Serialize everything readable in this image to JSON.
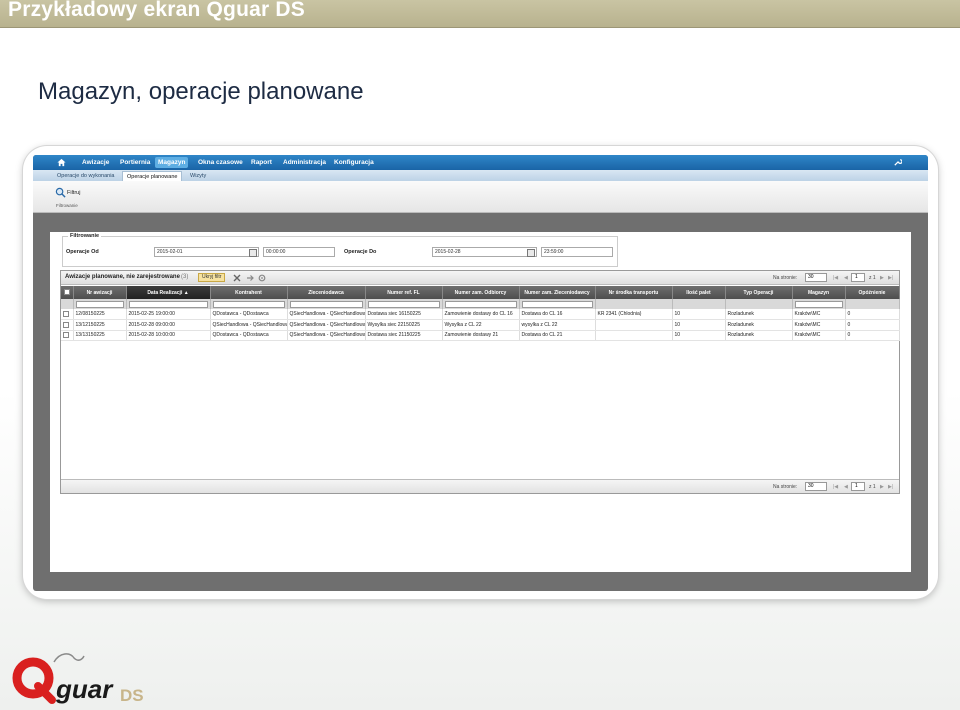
{
  "slide": {
    "header": "Przykładowy ekran Qguar DS",
    "title": "Magazyn, operacje planowane"
  },
  "app": {
    "nav": [
      "Awizacje",
      "Portiernia",
      "Magazyn",
      "Okna czasowe",
      "Raport",
      "Administracja",
      "Konfiguracja"
    ],
    "nav_active": "Magazyn",
    "subnav": [
      "Operacje do wykonania",
      "Operacje planowane",
      "Wizyty"
    ],
    "subnav_active": "Operacje planowane",
    "toolbar": {
      "filter_label": "Filtruj",
      "group_label": "Filtrowanie"
    },
    "filter": {
      "legend": "Filtrowanie",
      "from_label": "Operacje Od",
      "from_date": "2015-02-01",
      "from_time": "00:00:00",
      "to_label": "Operacje Do",
      "to_date": "2015-02-28",
      "to_time": "23:59:00"
    },
    "grid": {
      "title": "Awizacje planowane, nie zarejestrowane",
      "count": "(3)",
      "hide_filter": "Ukryj filtr",
      "per_page_label": "Na stronie:",
      "per_page": "30",
      "page": "1",
      "page_of": "z 1",
      "columns": [
        "Nr awizacji",
        "Data Realizacji",
        "Kontrahent",
        "Zleceniodawca",
        "Numer ref. FL",
        "Numer zam. Odbiorcy",
        "Numer zam. Zleceniodawcy",
        "Nr środka transportu",
        "Ilość palet",
        "Typ Operacji",
        "Magazyn",
        "Opóźnienie"
      ],
      "sorted_column": "Data Realizacji",
      "rows": [
        [
          "12/08150225",
          "2015-02-25 19:00:00",
          "QDostawca - QDostawca",
          "QSiecHandlowa - QSiecHandlowa",
          "Dostawa siec 16150225",
          "Zamowienie dostawy do CL 16",
          "Dostawa do CL 16",
          "KR 2341  (Chlodnia)",
          "10",
          "Rozladunek",
          "Kraków\\MC",
          "0"
        ],
        [
          "13/12150225",
          "2015-02-28 09:00:00",
          "QSiecHandlowa - QSiecHandlowa",
          "QSiecHandlowa - QSiecHandlowa",
          "Wysylka siec 22150225",
          "Wysylka z CL  22",
          "wysylka z  CL 22",
          "",
          "10",
          "Rozladunek",
          "Kraków\\MC",
          "0"
        ],
        [
          "13/13150225",
          "2015-02-28 10:00:00",
          "QDostawca - QDostawca",
          "QSiecHandlowa - QSiecHandlowa",
          "Dostawa siec 21150225",
          "Zamowienie dostawy 21",
          "Dostawa do CL 21",
          "",
          "10",
          "Rozladunek",
          "Kraków\\MC",
          "0"
        ]
      ]
    }
  },
  "logo": {
    "text_main": "guar",
    "text_suffix": "DS",
    "colors": {
      "red": "#d9201f",
      "black": "#1a1a1a",
      "beige": "#c8b58a"
    }
  }
}
